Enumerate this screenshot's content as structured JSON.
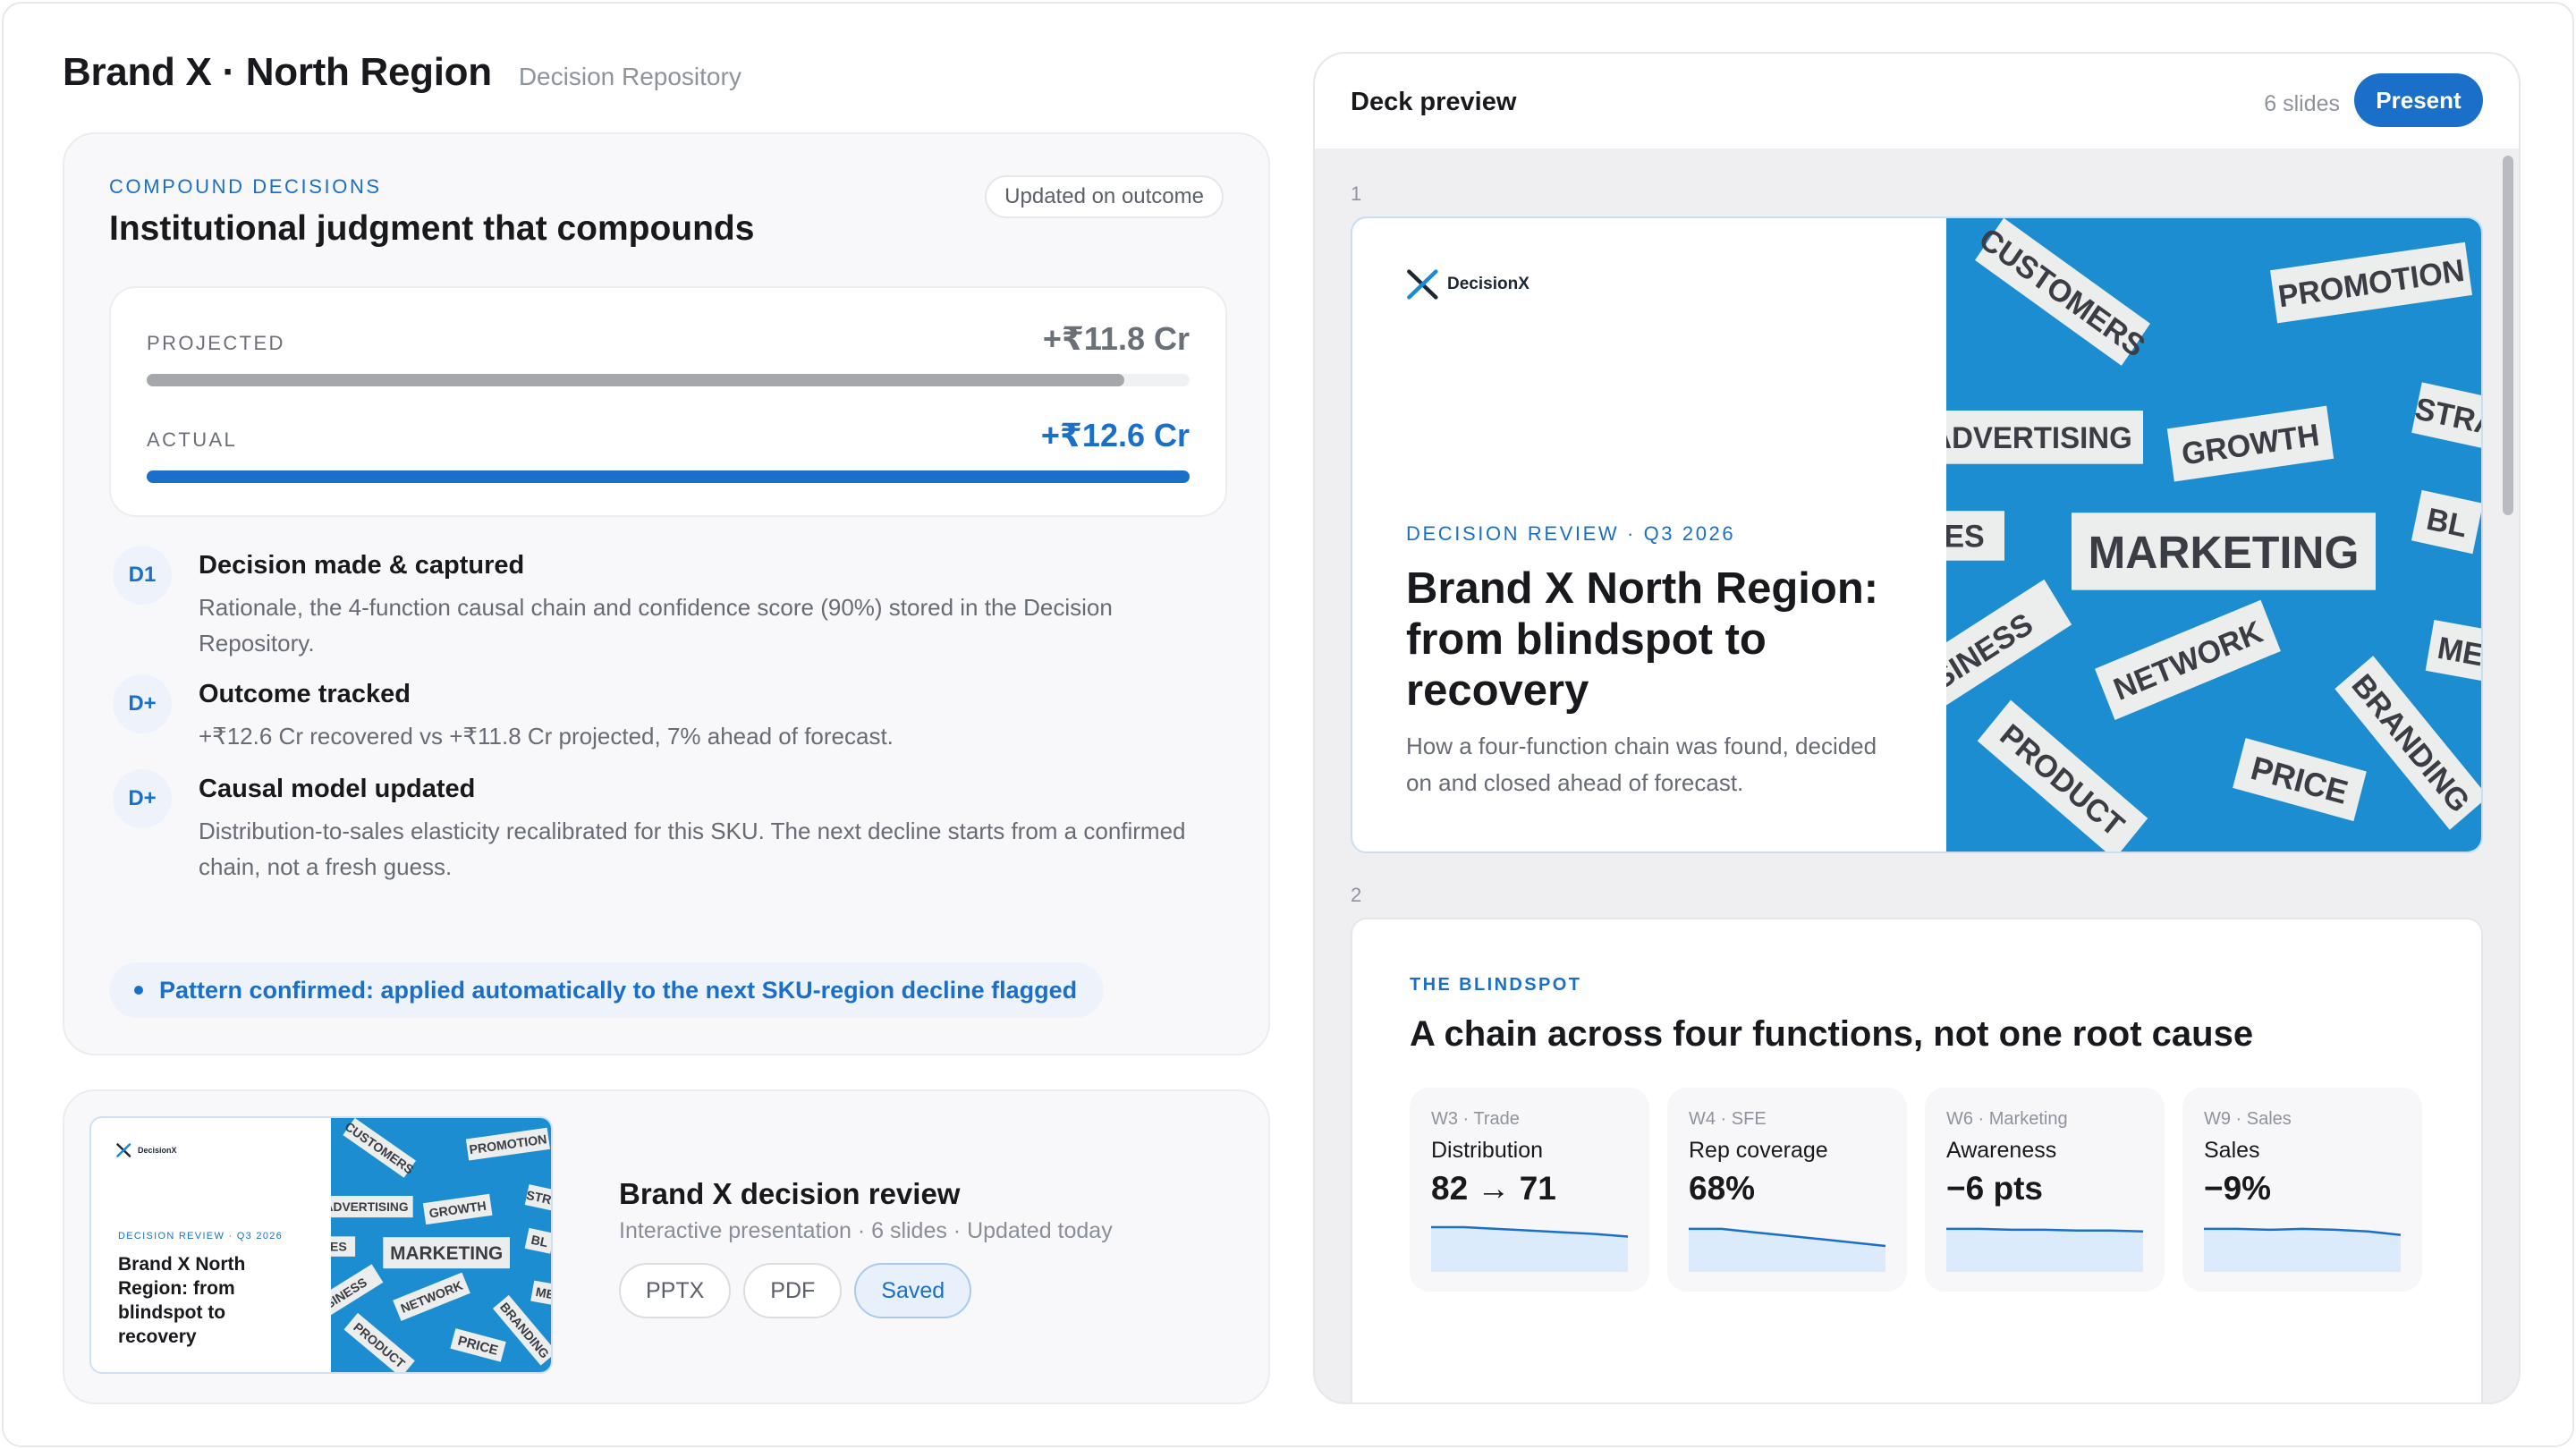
{
  "header": {
    "title": "Brand X · North Region",
    "subtitle": "Decision Repository"
  },
  "compound": {
    "eyebrow": "COMPOUND DECISIONS",
    "title": "Institutional judgment that compounds",
    "pill": "Updated on outcome",
    "projected": {
      "label": "PROJECTED",
      "value": "+₹11.8 Cr",
      "fill_fraction": 0.937
    },
    "actual": {
      "label": "ACTUAL",
      "value": "+₹12.6 Cr",
      "fill_fraction": 1.0
    },
    "steps": [
      {
        "badge": "D1",
        "title": "Decision made & captured",
        "desc": "Rationale, the 4-function causal chain and confidence score (90%) stored in the Decision Repository."
      },
      {
        "badge": "D+",
        "title": "Outcome tracked",
        "desc": "+₹12.6 Cr recovered vs +₹11.8 Cr projected, 7% ahead of forecast."
      },
      {
        "badge": "D+",
        "title": "Causal model updated",
        "desc": "Distribution-to-sales elasticity recalibrated for this SKU. The next decline starts from a confirmed chain, not a fresh guess."
      }
    ],
    "banner": "Pattern confirmed: applied automatically to the next SKU-region decline flagged"
  },
  "deck_card": {
    "title": "Brand X decision review",
    "meta": "Interactive presentation · 6 slides · Updated today",
    "chips": [
      "PPTX",
      "PDF",
      "Saved"
    ]
  },
  "deck": {
    "title": "Deck preview",
    "count": "6 slides",
    "present_label": "Present",
    "slide1": {
      "number": "1",
      "logo": "DecisionX",
      "eyebrow": "DECISION REVIEW · Q3 2026",
      "title": "Brand X North Region: from blindspot to recovery",
      "subtitle": "How a four-function chain was found, decided on and closed ahead of forecast.",
      "image_words": [
        "CUSTOMERS",
        "PROMOTION",
        "ADVERTISING",
        "GROWTH",
        "STRA",
        "MARKETING",
        "BL",
        "ES",
        "SINESS",
        "NETWORK",
        "ME",
        "PRODUCT",
        "PRICE",
        "BRANDING"
      ]
    },
    "slide2": {
      "number": "2",
      "eyebrow": "THE BLINDSPOT",
      "title": "A chain across four functions, not one root cause",
      "kpis": [
        {
          "week": "W3 · Trade",
          "name": "Distribution",
          "value": "82 → 71",
          "trend": [
            82,
            82,
            80,
            78,
            76,
            74,
            71
          ]
        },
        {
          "week": "W4 · SFE",
          "name": "Rep coverage",
          "value": "68%",
          "trend": [
            80,
            80,
            76,
            72,
            68,
            64,
            60
          ]
        },
        {
          "week": "W6 · Marketing",
          "name": "Awareness",
          "value": "−6 pts",
          "trend": [
            80,
            80,
            79,
            79,
            78,
            78,
            77
          ]
        },
        {
          "week": "W9 · Sales",
          "name": "Sales",
          "value": "−9%",
          "trend": [
            80,
            80,
            79,
            80,
            79,
            77,
            73
          ]
        }
      ]
    }
  },
  "colors": {
    "accent": "#1a70c8",
    "projected_bar": "#a6a7ab",
    "image_bg": "#1c8dd0"
  }
}
